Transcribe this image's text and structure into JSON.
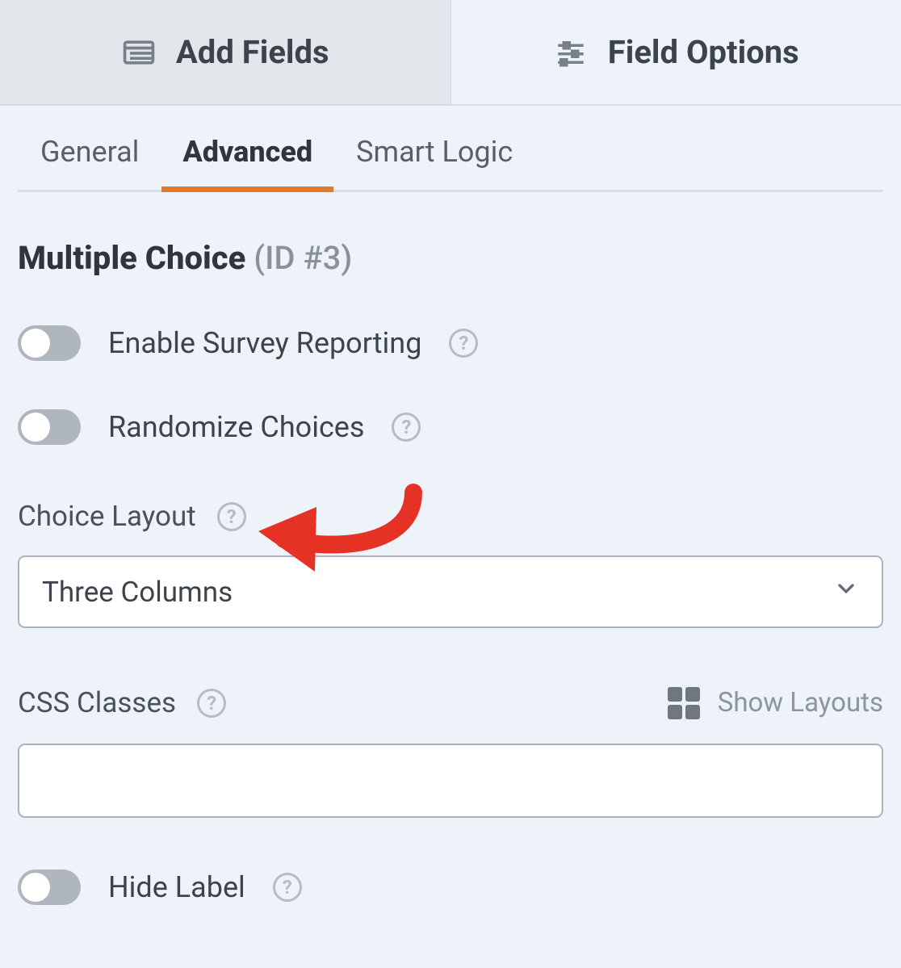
{
  "topTabs": {
    "addFields": "Add Fields",
    "fieldOptions": "Field Options"
  },
  "subTabs": {
    "general": "General",
    "advanced": "Advanced",
    "smartLogic": "Smart Logic",
    "active": "advanced"
  },
  "field": {
    "type": "Multiple Choice",
    "idLabel": "(ID #3)"
  },
  "options": {
    "enableSurvey": {
      "label": "Enable Survey Reporting",
      "on": false
    },
    "randomize": {
      "label": "Randomize Choices",
      "on": false
    },
    "choiceLayout": {
      "label": "Choice Layout",
      "selected": "Three Columns"
    },
    "cssClasses": {
      "label": "CSS Classes",
      "showLayouts": "Show Layouts",
      "value": ""
    },
    "hideLabel": {
      "label": "Hide Label",
      "on": false
    }
  }
}
